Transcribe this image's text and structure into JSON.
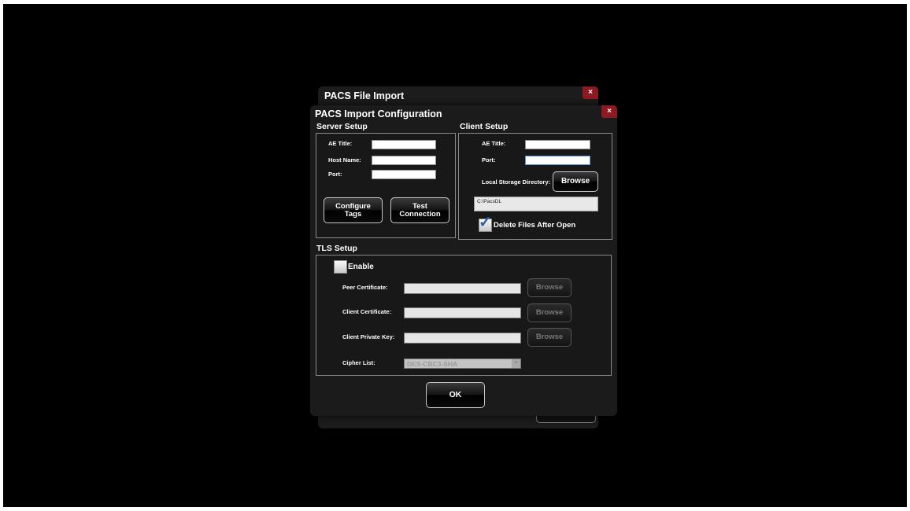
{
  "back_dialog": {
    "title": "PACS File Import",
    "close_glyph": "×"
  },
  "main_dialog": {
    "title": "PACS Import Configuration",
    "close_glyph": "×",
    "server_setup": {
      "title": "Server Setup",
      "ae_title_label": "AE Title:",
      "ae_title_value": "",
      "host_name_label": "Host Name:",
      "host_name_value": "",
      "port_label": "Port:",
      "port_value": "",
      "configure_tags_line1": "Configure",
      "configure_tags_line2": "Tags",
      "test_connection_line1": "Test",
      "test_connection_line2": "Connection"
    },
    "client_setup": {
      "title": "Client Setup",
      "ae_title_label": "AE Title:",
      "ae_title_value": "",
      "port_label": "Port:",
      "port_value": "",
      "local_storage_label": "Local Storage Directory:",
      "browse_label": "Browse",
      "storage_path": "C:\\PacsDL",
      "delete_files_label": "Delete Files After Open",
      "delete_files_checked": true,
      "check_glyph": "✓"
    },
    "tls_setup": {
      "title": "TLS Setup",
      "enable_label": "Enable",
      "enable_checked": false,
      "peer_certificate_label": "Peer Certificate:",
      "peer_certificate_value": "",
      "client_certificate_label": "Client Certificate:",
      "client_certificate_value": "",
      "client_private_key_label": "Client Private Key:",
      "client_private_key_value": "",
      "browse_label": "Browse",
      "cipher_list_label": "Cipher List:",
      "cipher_list_value": "DES-CBC3-SHA",
      "dropdown_glyph": "▼"
    },
    "ok_label": "OK"
  },
  "colors": {
    "background": "#000000",
    "dialog": "#1b1b1b",
    "close_button": "#8c1a22",
    "panel_border": "#8a8a8a"
  }
}
